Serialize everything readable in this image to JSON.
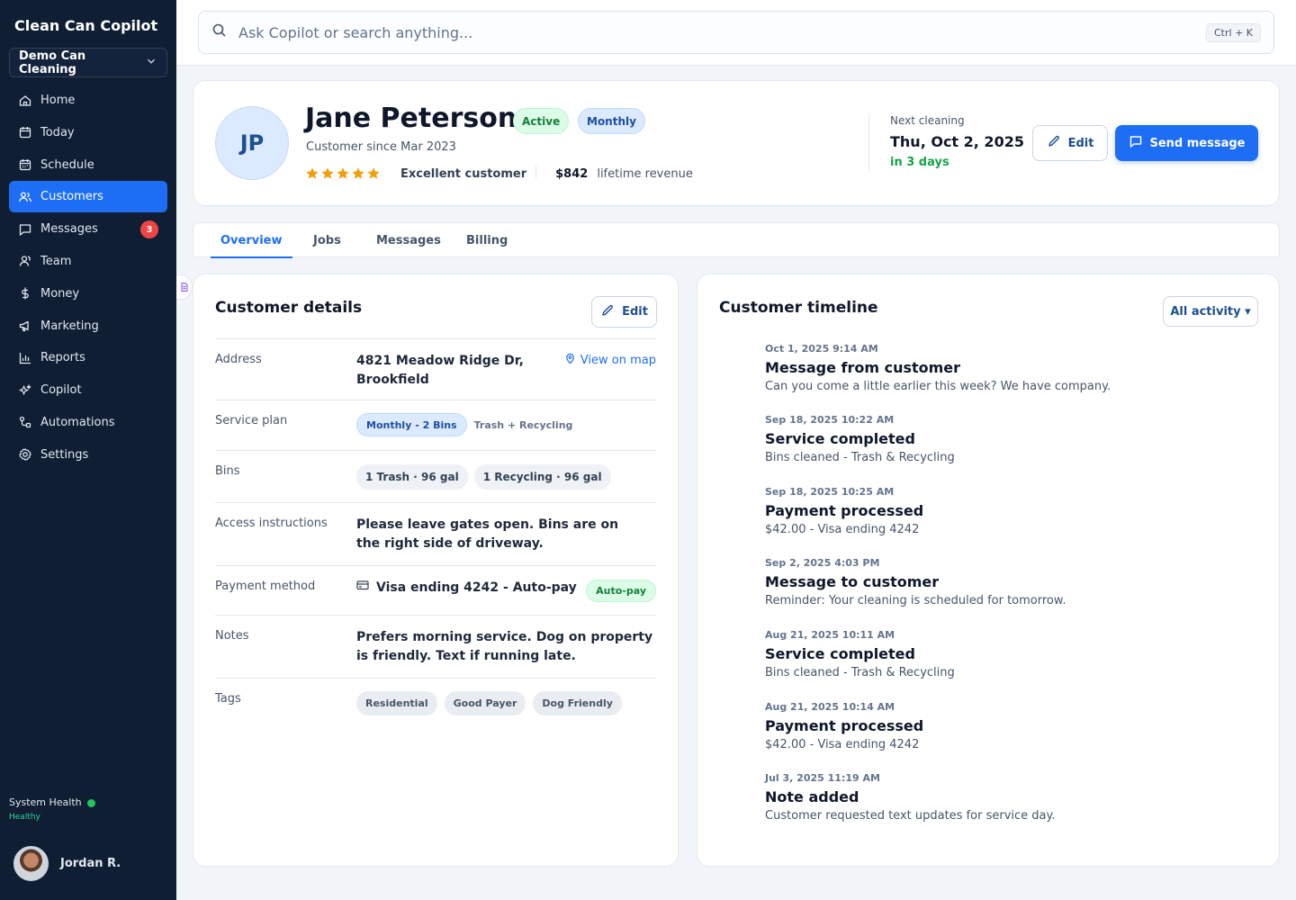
{
  "sidebar": {
    "brand": "Clean Can Copilot",
    "workspace": "Demo Can Cleaning",
    "items": [
      {
        "label": "Home",
        "icon": "home-icon"
      },
      {
        "label": "Today",
        "icon": "calendar-icon"
      },
      {
        "label": "Schedule",
        "icon": "calendar-grid-icon"
      },
      {
        "label": "Customers",
        "icon": "users-icon"
      },
      {
        "label": "Messages",
        "icon": "chat-icon",
        "badge": "3"
      },
      {
        "label": "Team",
        "icon": "team-icon"
      },
      {
        "label": "Money",
        "icon": "dollar-icon"
      },
      {
        "label": "Marketing",
        "icon": "megaphone-icon"
      },
      {
        "label": "Reports",
        "icon": "bar-chart-icon"
      },
      {
        "label": "Copilot",
        "icon": "sparkle-icon"
      },
      {
        "label": "Automations",
        "icon": "automation-icon"
      },
      {
        "label": "Settings",
        "icon": "gear-icon"
      }
    ],
    "health_label": "System Health",
    "health_status": "Healthy",
    "user_name": "Jordan R."
  },
  "search": {
    "placeholder": "Ask Copilot or search anything...",
    "shortcut": "Ctrl + K"
  },
  "customer": {
    "initials": "JP",
    "name": "Jane Peterson",
    "status": "Active",
    "frequency": "Monthly",
    "since": "Customer since Mar 2023",
    "rating": 5,
    "rating_label": "Excellent customer",
    "revenue": "$842",
    "revenue_label": "lifetime revenue",
    "next_label": "Next cleaning",
    "next_date": "Thu, Oct 2, 2025",
    "next_relative": "in 3 days",
    "edit_label": "Edit",
    "send_label": "Send message"
  },
  "tabs": [
    "Overview",
    "Jobs",
    "Messages",
    "Billing"
  ],
  "details": {
    "title": "Customer details",
    "edit_label": "Edit",
    "address_label": "Address",
    "address": "4821 Meadow Ridge Dr, Brookfield",
    "map_link": "View on map",
    "plan_label": "Service plan",
    "plan": "Monthly - 2 Bins",
    "plan_note": "Trash + Recycling",
    "bins_label": "Bins",
    "bins": [
      "1 Trash · 96 gal",
      "1 Recycling · 96 gal"
    ],
    "access_label": "Access instructions",
    "access": "Please leave gates open. Bins are on the right side of driveway.",
    "payment_label": "Payment method",
    "payment": "Visa ending 4242 - Auto-pay",
    "autopay": "Auto-pay",
    "notes_label": "Notes",
    "notes": "Prefers morning service. Dog on property is friendly. Text if running late.",
    "tags_label": "Tags",
    "tags": [
      "Residential",
      "Good Payer",
      "Dog Friendly"
    ]
  },
  "timeline": {
    "title": "Customer timeline",
    "filter": "All activity ▾",
    "events": [
      {
        "date": "Oct 1, 2025 9:14 AM",
        "title": "Message from customer",
        "desc": "Can you come a little earlier this week? We have company."
      },
      {
        "date": "Sep 18, 2025 10:22 AM",
        "title": "Service completed",
        "desc": "Bins cleaned - Trash & Recycling"
      },
      {
        "date": "Sep 18, 2025 10:25 AM",
        "title": "Payment processed",
        "desc": "$42.00 - Visa ending 4242"
      },
      {
        "date": "Sep 2, 2025 4:03 PM",
        "title": "Message to customer",
        "desc": "Reminder: Your cleaning is scheduled for tomorrow."
      },
      {
        "date": "Aug 21, 2025 10:11 AM",
        "title": "Service completed",
        "desc": "Bins cleaned - Trash & Recycling"
      },
      {
        "date": "Aug 21, 2025 10:14 AM",
        "title": "Payment processed",
        "desc": "$42.00 - Visa ending 4242"
      },
      {
        "date": "Jul 3, 2025 11:19 AM",
        "title": "Note added",
        "desc": "Customer requested text updates for service day."
      }
    ]
  },
  "colors": {
    "accent": "#1d6ef5",
    "sidebar": "#0f1e33",
    "success": "#16a34a",
    "star": "#f59e0b"
  }
}
